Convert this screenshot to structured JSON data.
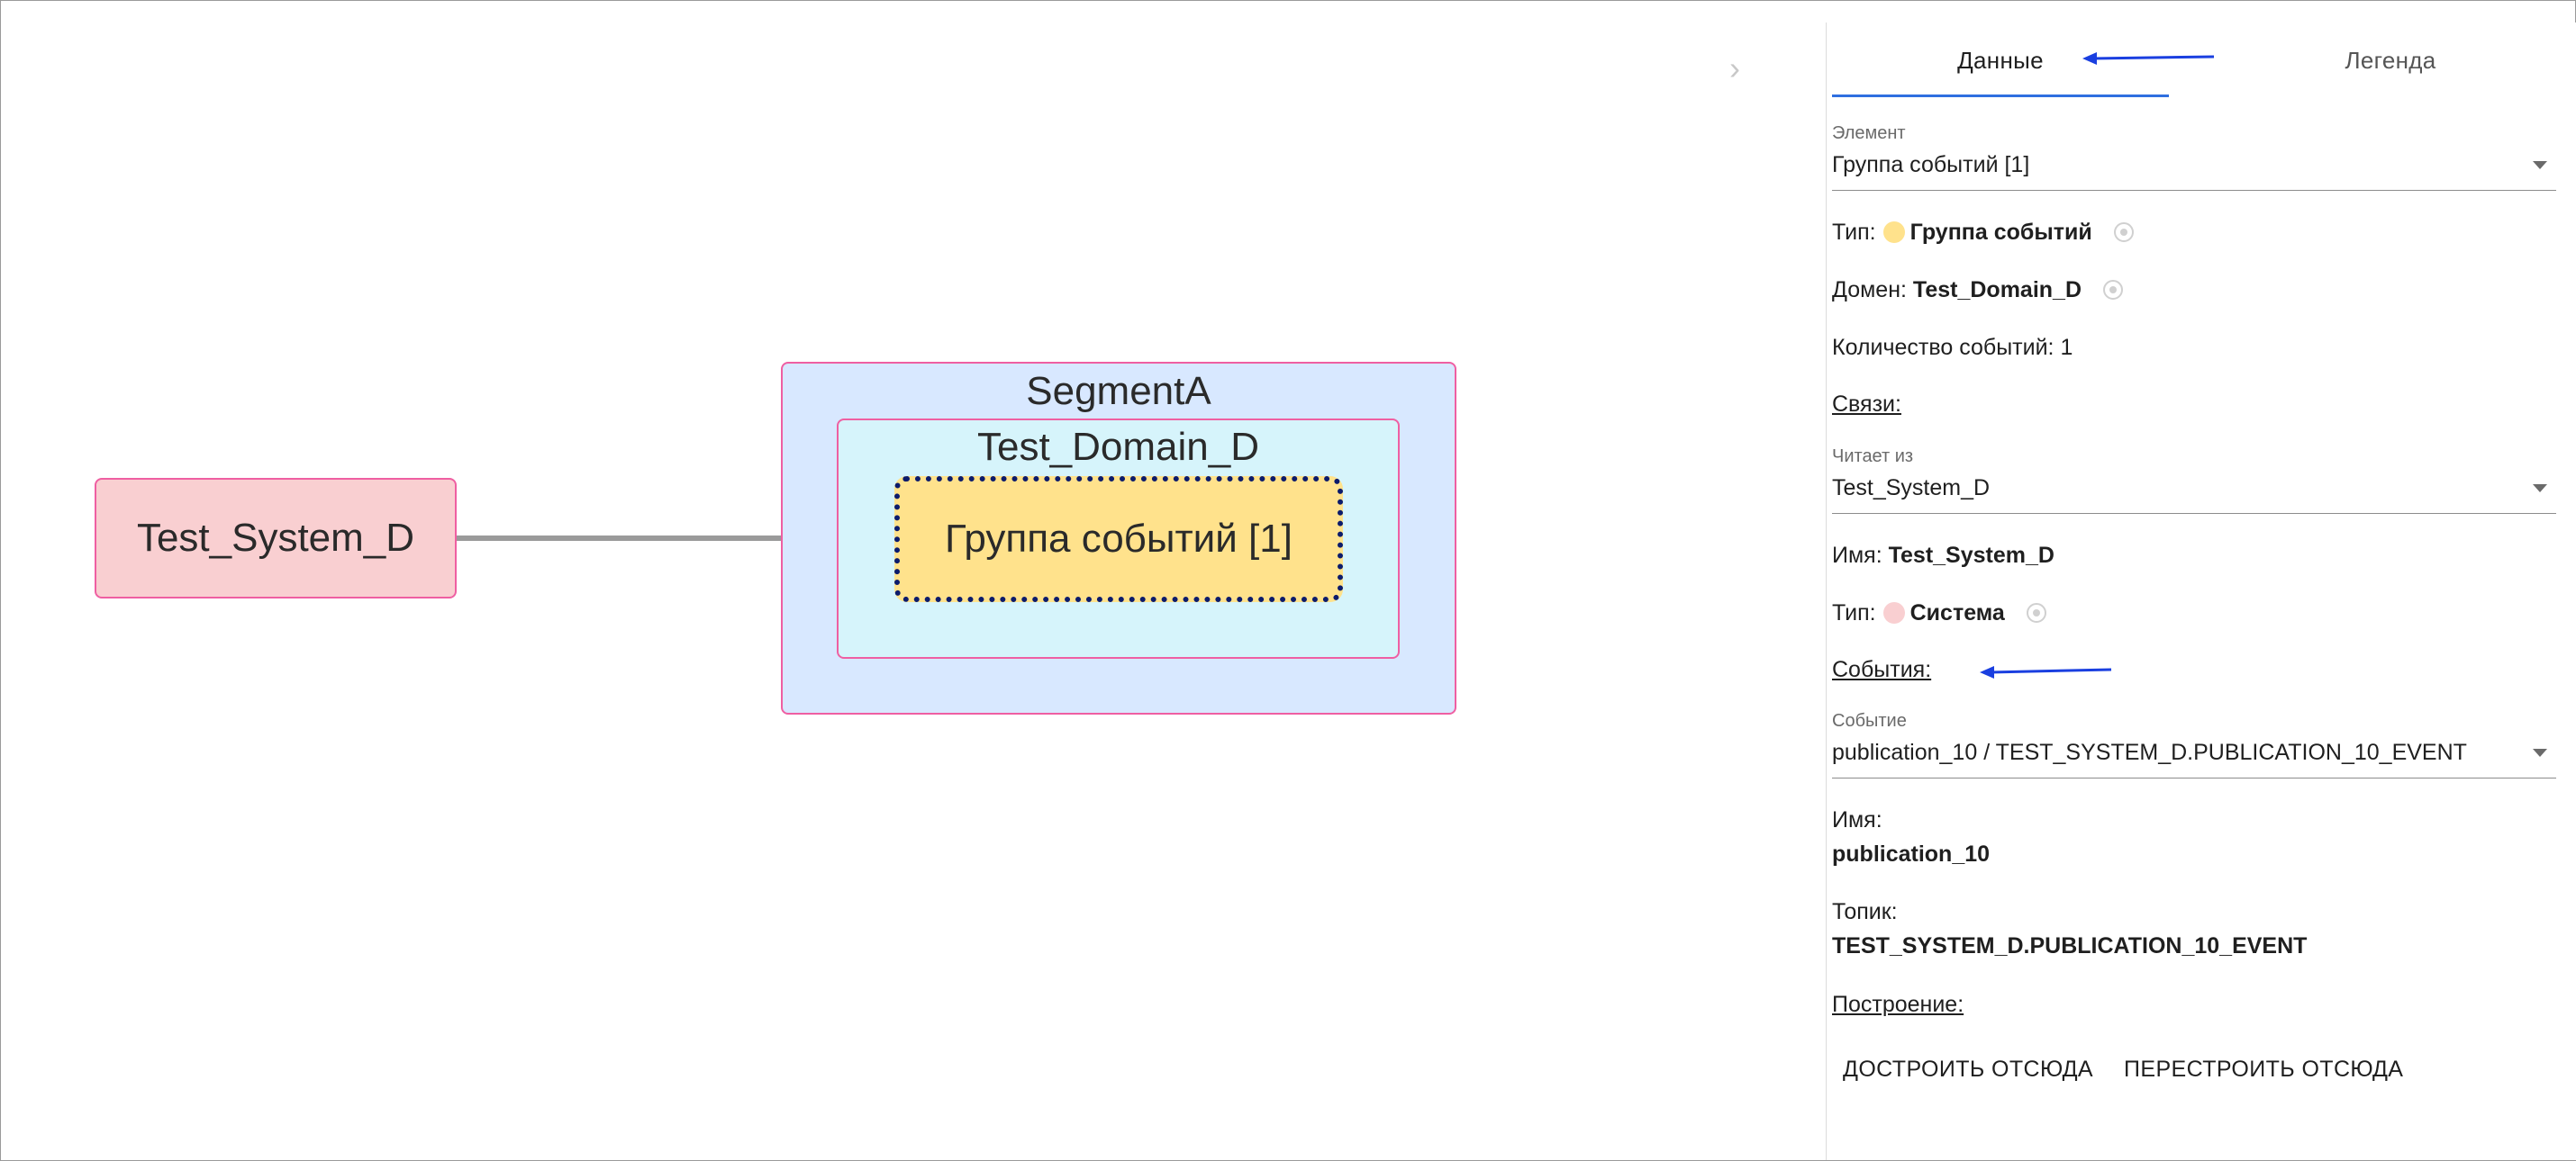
{
  "diagram": {
    "collapse_glyph": "›",
    "system_node": {
      "label": "Test_System_D"
    },
    "segment": {
      "label": "SegmentA"
    },
    "domain": {
      "label": "Test_Domain_D"
    },
    "event_group": {
      "label": "Группа событий [1]"
    }
  },
  "panel": {
    "tabs": [
      {
        "label": "Данные",
        "selected": true
      },
      {
        "label": "Легенда",
        "selected": false
      }
    ],
    "element_select": {
      "label": "Элемент",
      "value": "Группа событий [1]"
    },
    "type_row": {
      "prefix": "Тип:",
      "value": "Группа событий",
      "dot_color": "#ffe28c"
    },
    "domain_row": {
      "prefix": "Домен:",
      "value": "Test_Domain_D"
    },
    "events_count": "Количество событий: 1",
    "links_heading": "Связи:",
    "reads_from_select": {
      "label": "Читает из",
      "value": "Test_System_D"
    },
    "name_row": {
      "prefix": "Имя:",
      "value": "Test_System_D"
    },
    "system_type_row": {
      "prefix": "Тип:",
      "value": "Система",
      "dot_color": "#f9cfd1"
    },
    "events_heading": "События:",
    "event_select": {
      "label": "Событие",
      "value": "publication_10 / TEST_SYSTEM_D.PUBLICATION_10_EVENT"
    },
    "event_name": {
      "label": "Имя:",
      "value": "publication_10"
    },
    "topic": {
      "label": "Топик:",
      "value": "TEST_SYSTEM_D.PUBLICATION_10_EVENT"
    },
    "build_heading": "Построение:",
    "buttons": {
      "extend": "ДОСТРОИТЬ ОТСЮДА",
      "rebuild": "ПЕРЕСТРОИТЬ ОТСЮДА"
    }
  },
  "colors": {
    "accent": "#2f6fe0",
    "annotation_arrow": "#1a3fe0",
    "system_fill": "#f9cfd1",
    "segment_fill": "#d8e8ff",
    "domain_fill": "#d6f4fb",
    "event_group_fill": "#ffe28c",
    "border_pink": "#ef5fa2",
    "selection_dots": "#0c1b6b"
  }
}
